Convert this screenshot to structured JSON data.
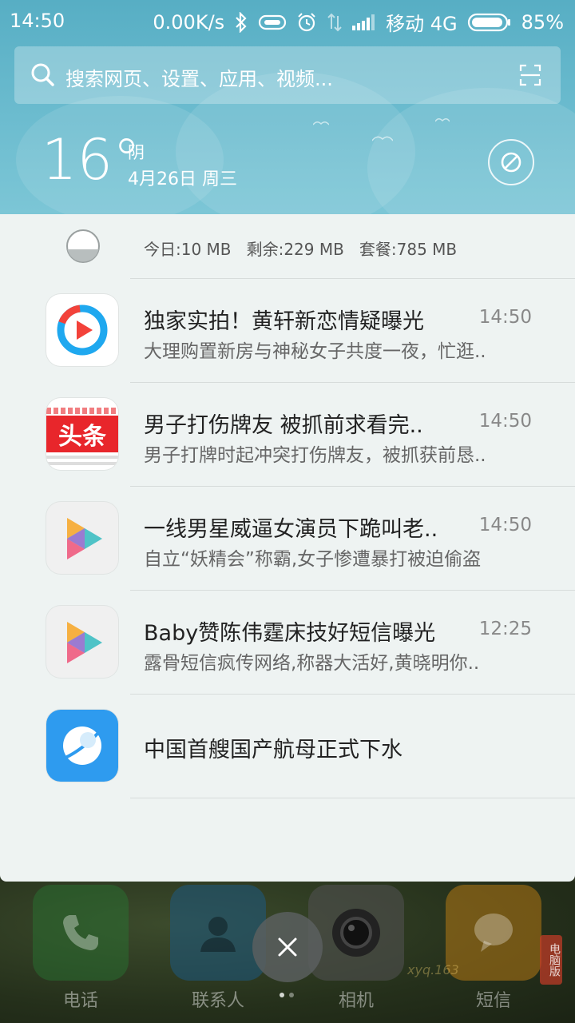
{
  "status_bar": {
    "time": "14:50",
    "net_speed": "0.00K/s",
    "carrier": "移动 4G",
    "battery": "85%"
  },
  "search": {
    "placeholder": "搜索网页、设置、应用、视频..."
  },
  "weather": {
    "temperature": "16°",
    "condition": "阴",
    "date": "4月26日 周三"
  },
  "data_usage": {
    "text": "今日:10 MB   剩余:229 MB   套餐:785 MB"
  },
  "notifications": [
    {
      "title": "独家实拍！黄轩新恋情疑曝光",
      "time": "14:50",
      "body": "大理购置新房与神秘女子共度一夜，忙逛..",
      "icon": "youku-icon"
    },
    {
      "title": "男子打伤牌友 被抓前求看完..",
      "time": "14:50",
      "body": "男子打牌时起冲突打伤牌友，被抓获前恳..",
      "icon": "toutiao-icon",
      "icon_text": "头条"
    },
    {
      "title": "一线男星威逼女演员下跪叫老..",
      "time": "14:50",
      "body": "自立“妖精会”称霸,女子惨遭暴打被迫偷盗",
      "icon": "video-play-icon"
    },
    {
      "title": "Baby赞陈伟霆床技好短信曝光",
      "time": "12:25",
      "body": "露骨短信疯传网络,称器大活好,黄晓明你..",
      "icon": "video-play-icon"
    },
    {
      "title": "中国首艘国产航母正式下水",
      "time": "",
      "body": "",
      "icon": "browser-icon"
    }
  ],
  "dock": {
    "items": [
      {
        "label": "电话",
        "icon": "phone-icon"
      },
      {
        "label": "联系人",
        "icon": "contacts-icon"
      },
      {
        "label": "相机",
        "icon": "camera-icon"
      },
      {
        "label": "短信",
        "icon": "messages-icon"
      }
    ],
    "badge": "电脑版",
    "watermark": "xyq.163"
  },
  "colors": {
    "header_bg": "#57aec4",
    "panel_bg": "#eef3f2",
    "toutiao_red": "#e8262b",
    "browser_blue": "#2e9bef"
  }
}
